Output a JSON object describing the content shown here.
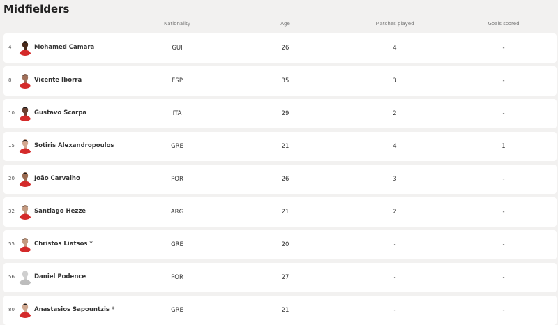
{
  "title": "Midfielders",
  "headers": [
    "Nationality",
    "Age",
    "Matches played",
    "Goals scored"
  ],
  "players": [
    {
      "number": "4",
      "name": "Mohamed Camara",
      "nationality": "GUI",
      "age": "26",
      "matches": "4",
      "goals": "-",
      "skin": "#4a2a1a",
      "photo": true
    },
    {
      "number": "8",
      "name": "Vicente Iborra",
      "nationality": "ESP",
      "age": "35",
      "matches": "3",
      "goals": "-",
      "skin": "#a0705a",
      "photo": true
    },
    {
      "number": "10",
      "name": "Gustavo Scarpa",
      "nationality": "ITA",
      "age": "29",
      "matches": "2",
      "goals": "-",
      "skin": "#6b4030",
      "photo": true
    },
    {
      "number": "15",
      "name": "Sotiris Alexandropoulos",
      "nationality": "GRE",
      "age": "21",
      "matches": "4",
      "goals": "1",
      "skin": "#d4a890",
      "photo": true
    },
    {
      "number": "20",
      "name": "João Carvalho",
      "nationality": "POR",
      "age": "26",
      "matches": "3",
      "goals": "-",
      "skin": "#9a6a50",
      "photo": true
    },
    {
      "number": "32",
      "name": "Santiago Hezze",
      "nationality": "ARG",
      "age": "21",
      "matches": "2",
      "goals": "-",
      "skin": "#c49a80",
      "photo": true
    },
    {
      "number": "55",
      "name": "Christos Liatsos *",
      "nationality": "GRE",
      "age": "20",
      "matches": "-",
      "goals": "-",
      "skin": "#c49a80",
      "photo": true
    },
    {
      "number": "56",
      "name": "Daniel Podence",
      "nationality": "POR",
      "age": "27",
      "matches": "-",
      "goals": "-",
      "skin": "#cfcfcf",
      "photo": false
    },
    {
      "number": "80",
      "name": "Anastasios Sapountzis *",
      "nationality": "GRE",
      "age": "21",
      "matches": "-",
      "goals": "-",
      "skin": "#d0a890",
      "photo": true
    }
  ]
}
